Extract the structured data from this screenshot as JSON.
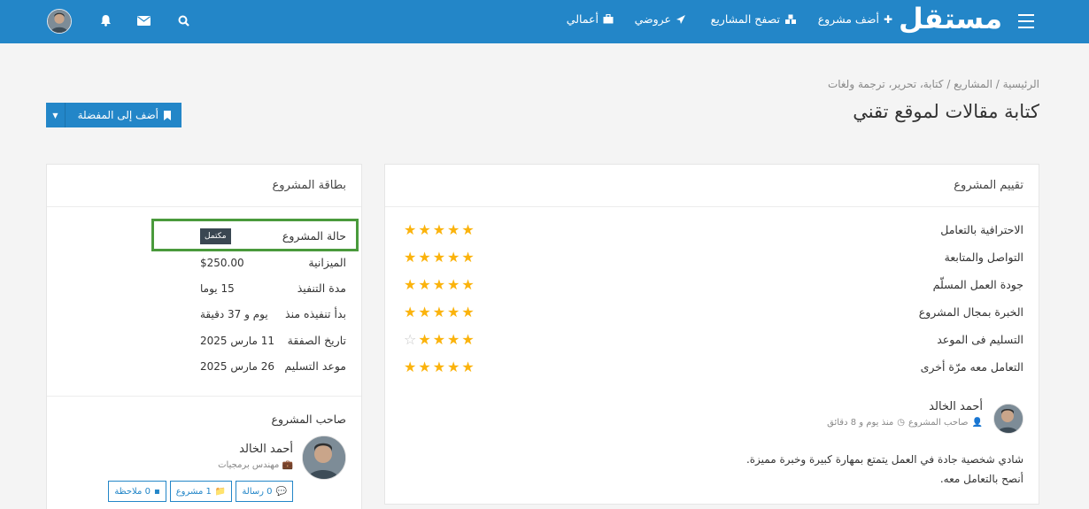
{
  "topbar": {
    "logo": "مستقل",
    "nav": [
      {
        "label": "أضف مشروع",
        "icon": "plus-icon"
      },
      {
        "label": "تصفح المشاريع",
        "icon": "cubes-icon"
      },
      {
        "label": "عروضي",
        "icon": "paper-plane-icon"
      },
      {
        "label": "أعمالي",
        "icon": "briefcase-icon"
      }
    ],
    "icons": [
      "search-icon",
      "envelope-icon",
      "bell-icon",
      "avatar"
    ]
  },
  "breadcrumb": "الرئيسية / المشاريع / كتابة، تحرير، ترجمة ولغات",
  "page_title": "كتابة مقالات لموقع تقني",
  "favorite_button": "أضف إلى المفضلة",
  "rating": {
    "title": "تقييم المشروع",
    "rows": [
      {
        "label": "الاحترافية بالتعامل",
        "stars": 5
      },
      {
        "label": "التواصل والمتابعة",
        "stars": 5
      },
      {
        "label": "جودة العمل المسلّم",
        "stars": 5
      },
      {
        "label": "الخبرة بمجال المشروع",
        "stars": 5
      },
      {
        "label": "التسليم فى الموعد",
        "stars": 4
      },
      {
        "label": "التعامل معه مرّة أخرى",
        "stars": 5
      }
    ],
    "review": {
      "name": "أحمد الخالد",
      "role": "صاحب المشروع",
      "time": "منذ يوم و 8 دقائق",
      "line1": "شادي شخصية جادة في العمل يتمتع بمهارة كبيرة وخبرة مميزة.",
      "line2": "أنصح بالتعامل معه."
    }
  },
  "card": {
    "title": "بطاقة المشروع",
    "rows": [
      {
        "key": "حالة المشروع",
        "value": "مكتمل"
      },
      {
        "key": "الميزانية",
        "value": "$250.00"
      },
      {
        "key": "مدة التنفيذ",
        "value": "15 يوما"
      },
      {
        "key": "بدأ تنفيذه منذ",
        "value": "يوم و 37 دقيقة"
      },
      {
        "key": "تاريخ الصفقة",
        "value": "11 مارس 2025"
      },
      {
        "key": "موعد التسليم",
        "value": "26 مارس 2025"
      }
    ],
    "owner": {
      "title": "صاحب المشروع",
      "name": "أحمد الخالد",
      "role": "مهندس برمجيات",
      "buttons": [
        "0 رسالة",
        "1 مشروع",
        "0 ملاحظة"
      ]
    }
  },
  "colors": {
    "primary": "#2386c8",
    "star": "#fbb30c",
    "highlight": "#4a9a3c"
  }
}
